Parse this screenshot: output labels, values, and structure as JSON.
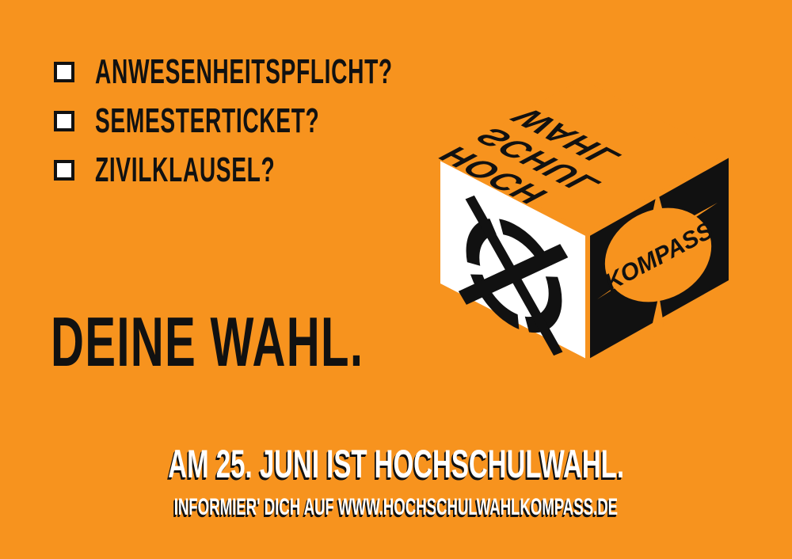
{
  "checklist": {
    "items": [
      {
        "label": "ANWESENHEITSPFLICHT?"
      },
      {
        "label": "SEMESTERTICKET?"
      },
      {
        "label": "ZIVILKLAUSEL?"
      }
    ]
  },
  "headline": "DEINE WAHL.",
  "cube": {
    "top_lines": [
      "HOCH",
      "SCHUL",
      "WAHL"
    ],
    "logo_text": "KOMPASS",
    "left_face_icon": "ballot-cross-icon",
    "right_face_icon": "compass-icon"
  },
  "footer": {
    "line1": "AM 25. JUNI IST HOCHSCHULWAHL.",
    "line2": "INFORMIER' DICH AUF WWW.HOCHSCHULWAHLKOMPASS.DE"
  },
  "colors": {
    "background": "#F7931E",
    "ink": "#111111",
    "paper": "#FFFFFF"
  }
}
